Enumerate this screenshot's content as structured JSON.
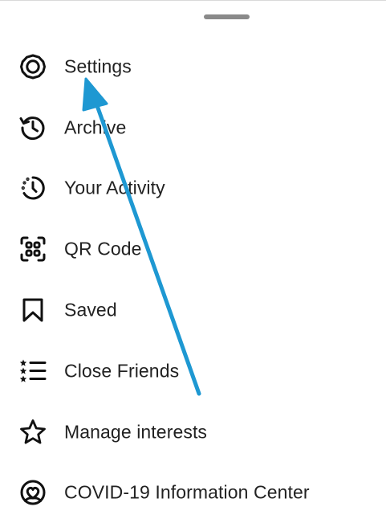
{
  "drag_handle": {
    "icon": "drag-handle"
  },
  "menu": {
    "items": [
      {
        "label": "Settings",
        "icon": "gear-icon"
      },
      {
        "label": "Archive",
        "icon": "archive-history-icon"
      },
      {
        "label": "Your Activity",
        "icon": "activity-clock-icon"
      },
      {
        "label": "QR Code",
        "icon": "qr-code-icon"
      },
      {
        "label": "Saved",
        "icon": "bookmark-icon"
      },
      {
        "label": "Close Friends",
        "icon": "close-friends-list-icon"
      },
      {
        "label": "Manage interests",
        "icon": "star-icon"
      },
      {
        "label": "COVID-19 Information Center",
        "icon": "covid-info-icon"
      }
    ]
  },
  "annotation": {
    "color": "#1e98d2",
    "icon": "arrow-pointer"
  },
  "colors": {
    "text": "#222222",
    "icon": "#111111",
    "handle": "#8a8a8a",
    "background": "#ffffff"
  }
}
